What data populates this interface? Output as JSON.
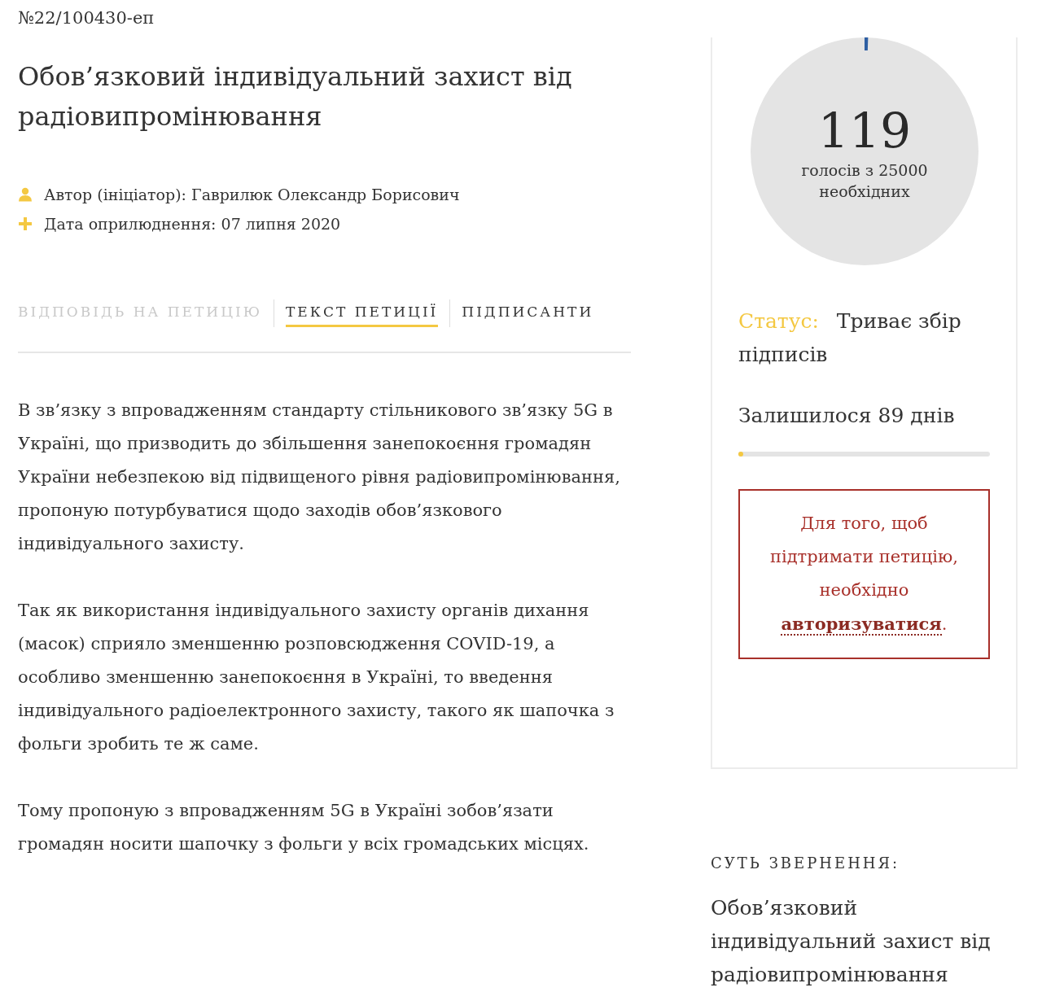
{
  "petition_number": "№22/100430-еп",
  "title": "Обов’язковий індивідуальний захист від радіовипромінювання",
  "meta": [
    {
      "kind": "author",
      "text": "Автор (ініціатор): Гаврилюк Олександр Борисович"
    },
    {
      "kind": "date",
      "text": "Дата оприлюднення: 07 липня 2020"
    }
  ],
  "tabs": [
    {
      "label": "ВІДПОВІДЬ НА ПЕТИЦІЮ",
      "selected": false,
      "disabled": true
    },
    {
      "label": "ТЕКСТ ПЕТИЦІЇ",
      "selected": true,
      "disabled": false
    },
    {
      "label": "ПІДПИСАНТИ",
      "selected": false,
      "disabled": false
    }
  ],
  "paragraphs": [
    "В зв’язку з впровадженням стандарту стільникового зв’язку 5G в Україні, що призводить до збільшення занепокоєння громадян України небезпекою від підвищеного рівня радіовипромінювання, пропоную потурбуватися щодо заходів обов’язкового індивідуального захисту.",
    "Так як використання індивідуального захисту органів дихання (масок) сприяло зменшенню розповсюдження COVID-19, а особливо зменшенню занепокоєння в Україні, то введення індивідуального радіоелектронного захисту, такого як шапочка з фольги зробить те ж саме.",
    "Тому пропоную з впровадженням 5G в Україні зобов’язати громадян носити шапочку з фольги у всіх громадських місцях."
  ],
  "sidebar": {
    "votes": {
      "count": "119",
      "caption_1": "голосів з 25000",
      "caption_2": "необхідних",
      "level": 0.005
    },
    "status": {
      "label": "Статус:",
      "value": "Триває збір підписів"
    },
    "remaining": {
      "text": "Залишилося 89 днів",
      "level": 0.02
    },
    "auth_notice": {
      "text": "Для того, щоб підтримати петицію, необхідно",
      "link": "авторизуватися",
      "suffix": "."
    }
  },
  "summary": {
    "heading": "СУТЬ ЗВЕРНЕННЯ:",
    "text": "Обов’язковий індивідуальний захист від радіовипромінювання"
  }
}
